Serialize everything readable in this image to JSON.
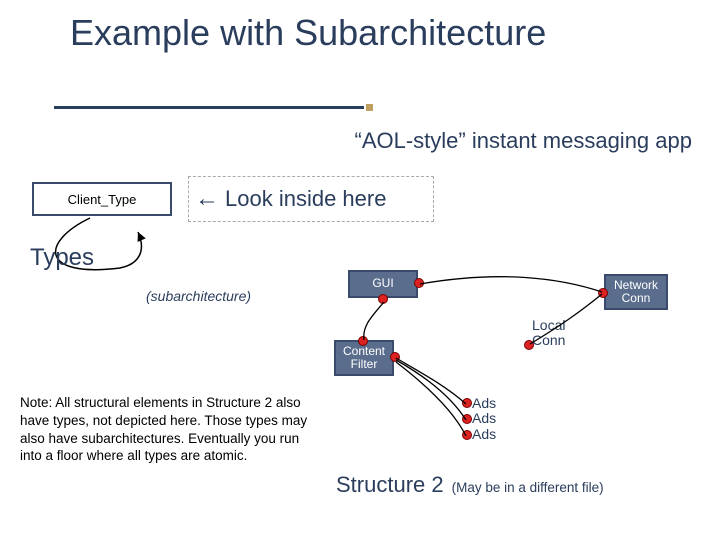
{
  "title": "Example with Subarchitecture",
  "subtitle": "“AOL-style” instant messaging app",
  "client_type_label": "Client_Type",
  "look_inside": "Look inside here",
  "types_heading": "Types",
  "subarchitecture_label": "(subarchitecture)",
  "note_text": "Note: All structural elements in Structure 2 also have types, not depicted here.  Those types may also have subarchitectures.  Eventually you run into a floor where all types are atomic.",
  "boxes": {
    "gui": "GUI",
    "content_filter": "Content\nFilter",
    "network_conn": "Network\nConn"
  },
  "local_conn": "Local\nConn",
  "ads_lines": [
    "Ads",
    "Ads",
    "Ads"
  ],
  "structure2": "Structure 2",
  "structure2_note": "(May be in a different file)"
}
